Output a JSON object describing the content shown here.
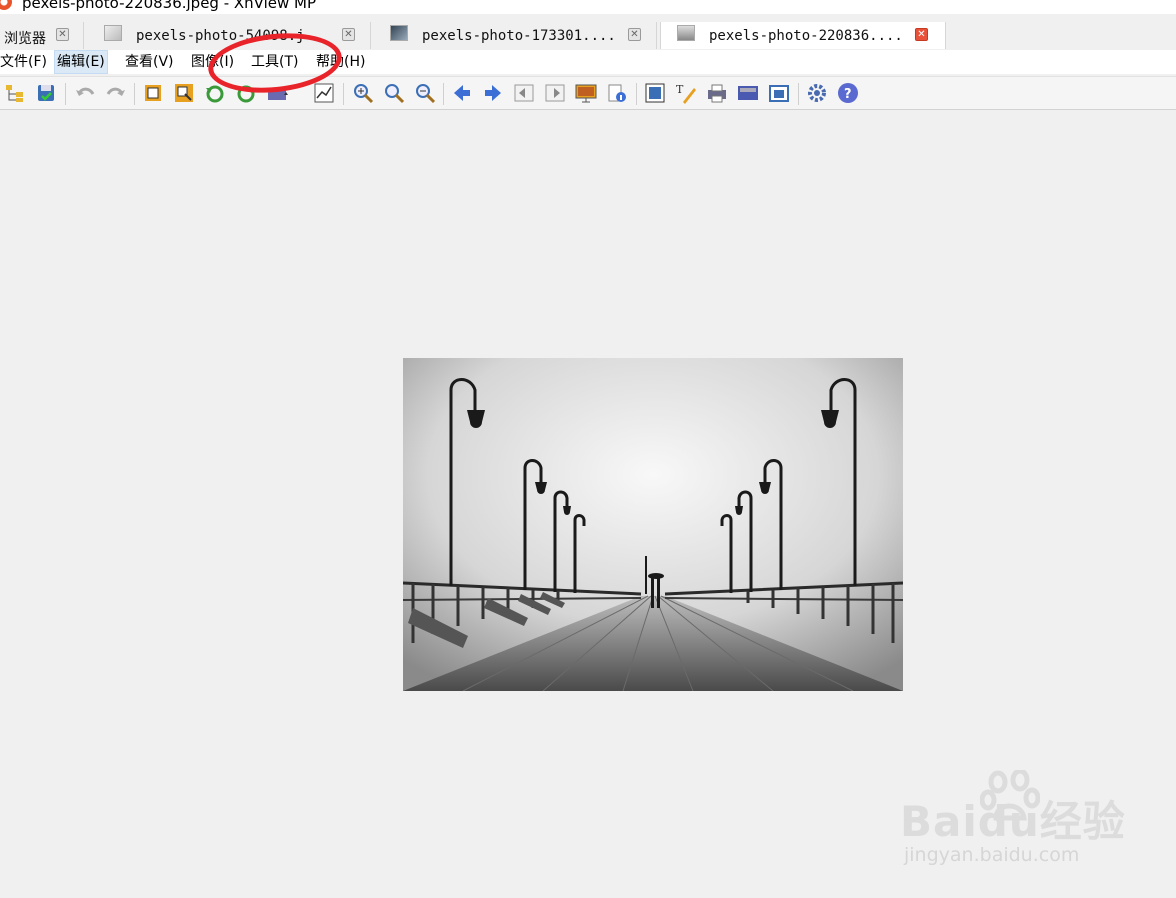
{
  "window": {
    "title": "pexels-photo-220836.jpeg - XnView MP"
  },
  "tabs": [
    {
      "label": "浏览器",
      "active": false
    },
    {
      "label": "pexels-photo-54098.j",
      "active": false
    },
    {
      "label": "pexels-photo-173301....",
      "active": false
    },
    {
      "label": "pexels-photo-220836....",
      "active": true
    }
  ],
  "menu": {
    "file": "文件(F)",
    "edit": "编辑(E)",
    "view": "查看(V)",
    "image": "图像(I)",
    "tools": "工具(T)",
    "help": "帮助(H)"
  },
  "toolbar": {
    "icons": [
      "browser-icon",
      "save-icon",
      "undo-icon",
      "redo-icon",
      "crop-icon",
      "resize-icon",
      "rotate-left-icon",
      "rotate-right-icon",
      "adjust-icon",
      "levels-icon",
      "zoom-in-icon",
      "zoom-fit-icon",
      "zoom-out-icon",
      "prev-icon",
      "next-icon",
      "first-icon",
      "last-icon",
      "slideshow-icon",
      "info-icon",
      "fullscreen-icon",
      "edit-text-icon",
      "print-icon",
      "scan-icon",
      "capture-icon",
      "settings-icon",
      "help-icon"
    ]
  },
  "colors": {
    "annotation": "#e8232a",
    "active_close": "#e8523a"
  },
  "watermark": {
    "main": "Baidu经验",
    "sub": "jingyan.baidu.com"
  }
}
